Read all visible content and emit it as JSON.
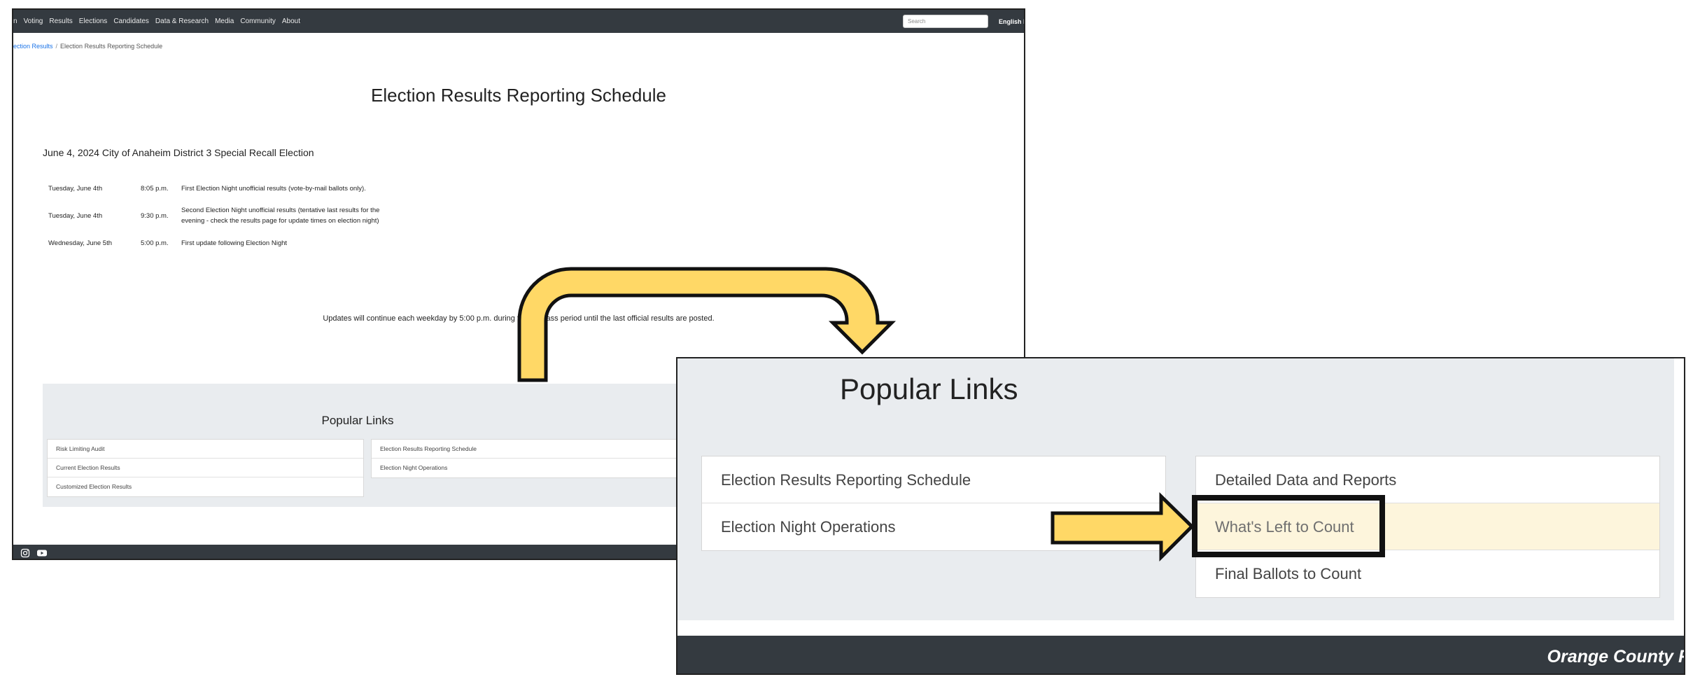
{
  "main": {
    "nav": {
      "items": [
        "n",
        "Voting",
        "Results",
        "Elections",
        "Candidates",
        "Data & Research",
        "Media",
        "Community",
        "About"
      ],
      "search_placeholder": "Search",
      "language": "English  E"
    },
    "breadcrumb": {
      "parent": "ection Results",
      "separator": "/",
      "current": "Election Results Reporting Schedule"
    },
    "page_title": "Election Results Reporting Schedule",
    "election_name": "June 4, 2024 City of Anaheim District 3 Special Recall Election",
    "schedule": [
      {
        "day": "Tuesday, June 4th",
        "time": "8:05 p.m.",
        "desc_lines": [
          "First Election Night unofficial results (vote-by-mail ballots only)."
        ]
      },
      {
        "day": "Tuesday, June 4th",
        "time": "9:30 p.m.",
        "desc_lines": [
          "Second Election Night unofficial results (tentative last results for the",
          "evening - check the results page for update times on election night)"
        ]
      },
      {
        "day": "Wednesday, June 5th",
        "time": "5:00 p.m.",
        "desc_lines": [
          "First update following Election Night"
        ]
      }
    ],
    "updates_note": "Updates will continue each weekday by 5:00 p.m. during the canvass period until the last official results are posted.",
    "popular_links": {
      "title": "Popular Links",
      "col1": [
        "Risk Limiting Audit",
        "Current Election Results",
        "Customized Election Results"
      ],
      "col2": [
        "Election Results Reporting Schedule",
        "Election Night Operations"
      ]
    },
    "footer_icons": [
      "instagram-icon",
      "youtube-icon"
    ]
  },
  "zoom": {
    "title": "Popular Links",
    "col1": [
      "Election Results Reporting Schedule",
      "Election Night Operations"
    ],
    "col2": [
      "Detailed Data and Reports",
      "What's Left to Count",
      "Final Ballots to Count"
    ],
    "highlighted_item": "What's Left to Count",
    "footer_brand": "Orange County Re"
  },
  "colors": {
    "nav_bg": "#343a40",
    "link_blue": "#1a73e8",
    "popular_bg": "#e9ecef",
    "highlight_fill": "#fdf5dc",
    "arrow_fill": "#ffd866",
    "arrow_stroke": "#111111"
  }
}
